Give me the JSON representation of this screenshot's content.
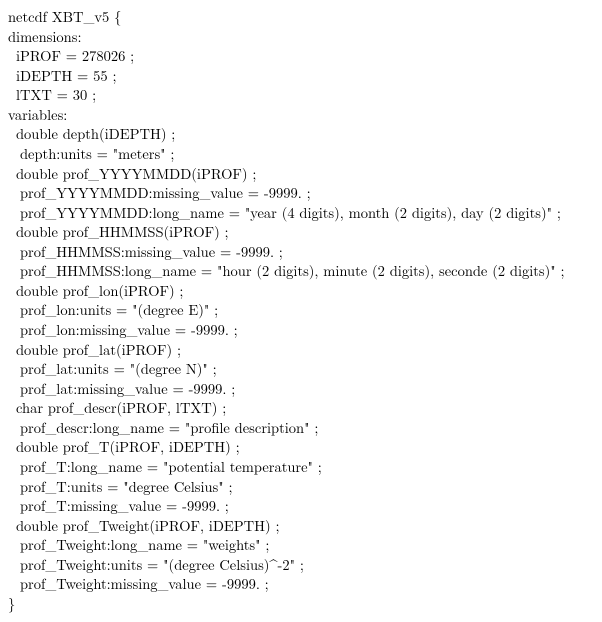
{
  "header": {
    "open": "netcdf XBT_v5 {",
    "close": "}"
  },
  "sections": {
    "dimensions_label": "dimensions:",
    "variables_label": "variables:"
  },
  "dimensions": {
    "iPROF": "iPROF = 278026 ;",
    "iDEPTH": "iDEPTH = 55 ;",
    "lTXT": "lTXT = 30 ;"
  },
  "vars": {
    "depth_decl": "double depth(iDEPTH) ;",
    "depth_units": "depth:units = \"meters\" ;",
    "yyyymmdd_decl": "double prof_YYYYMMDD(iPROF) ;",
    "yyyymmdd_missing": "prof_YYYYMMDD:missing_value = -9999. ;",
    "yyyymmdd_long": "prof_YYYYMMDD:long_name = \"year (4 digits), month (2 digits), day (2 digits)\" ;",
    "hhmmss_decl": "double prof_HHMMSS(iPROF) ;",
    "hhmmss_missing": "prof_HHMMSS:missing_value = -9999. ;",
    "hhmmss_long": "prof_HHMMSS:long_name = \"hour (2 digits), minute (2 digits), seconde (2 digits)\" ;",
    "lon_decl": "double prof_lon(iPROF) ;",
    "lon_units": "prof_lon:units = \"(degree E)\" ;",
    "lon_missing": "prof_lon:missing_value = -9999. ;",
    "lat_decl": "double prof_lat(iPROF) ;",
    "lat_units": "prof_lat:units = \"(degree N)\" ;",
    "lat_missing": "prof_lat:missing_value = -9999. ;",
    "descr_decl": "char prof_descr(iPROF, lTXT) ;",
    "descr_long": "prof_descr:long_name = \"profile description\" ;",
    "t_decl": "double prof_T(iPROF, iDEPTH) ;",
    "t_long": "prof_T:long_name = \"potential temperature\" ;",
    "t_units": "prof_T:units = \"degree Celsius\" ;",
    "t_missing": "prof_T:missing_value = -9999. ;",
    "tw_decl": "double prof_Tweight(iPROF, iDEPTH) ;",
    "tw_long": "prof_Tweight:long_name = \"weights\" ;",
    "tw_units": "prof_Tweight:units = \"(degree Celsius)^-2\" ;",
    "tw_missing": "prof_Tweight:missing_value = -9999. ;"
  }
}
